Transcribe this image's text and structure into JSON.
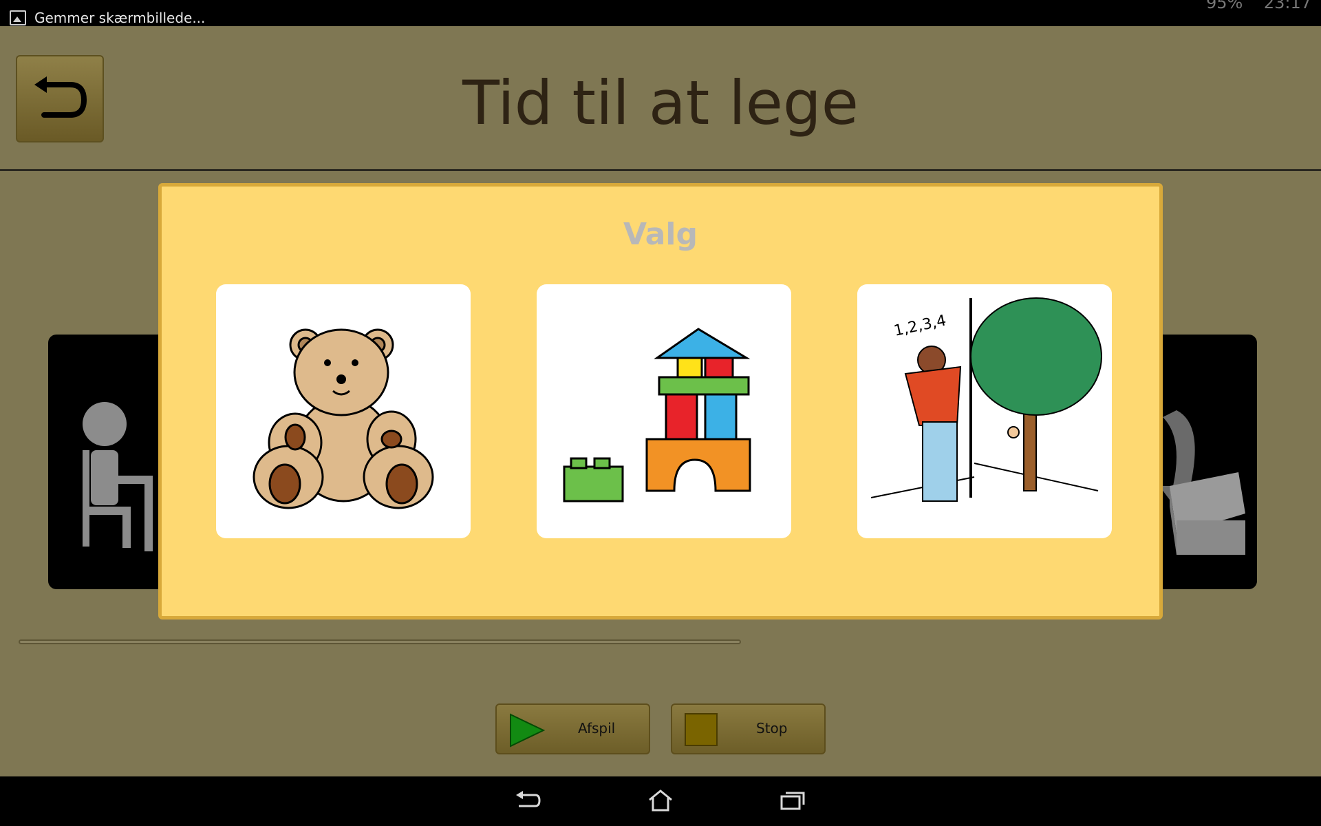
{
  "statusbar": {
    "notification_text": "Gemmer skærmbillede...",
    "battery": "95%",
    "time": "23:17"
  },
  "header": {
    "title": "Tid til at lege",
    "back_icon": "undo-arrow-icon"
  },
  "dialog": {
    "title": "Valg",
    "choices": [
      {
        "icon": "teddy-bear-icon"
      },
      {
        "icon": "building-blocks-icon"
      },
      {
        "icon": "hide-and-seek-icon"
      }
    ]
  },
  "controls": {
    "play_label": "Afspil",
    "stop_label": "Stop"
  },
  "navbar": {
    "back_icon": "back-icon",
    "home_icon": "home-icon",
    "recents_icon": "recent-apps-icon"
  },
  "colors": {
    "background": "#7f7753",
    "dialog": "#fed972",
    "dialog_border": "#d8a93a",
    "play_green": "#128a12",
    "stop_olive": "#7a6400"
  }
}
